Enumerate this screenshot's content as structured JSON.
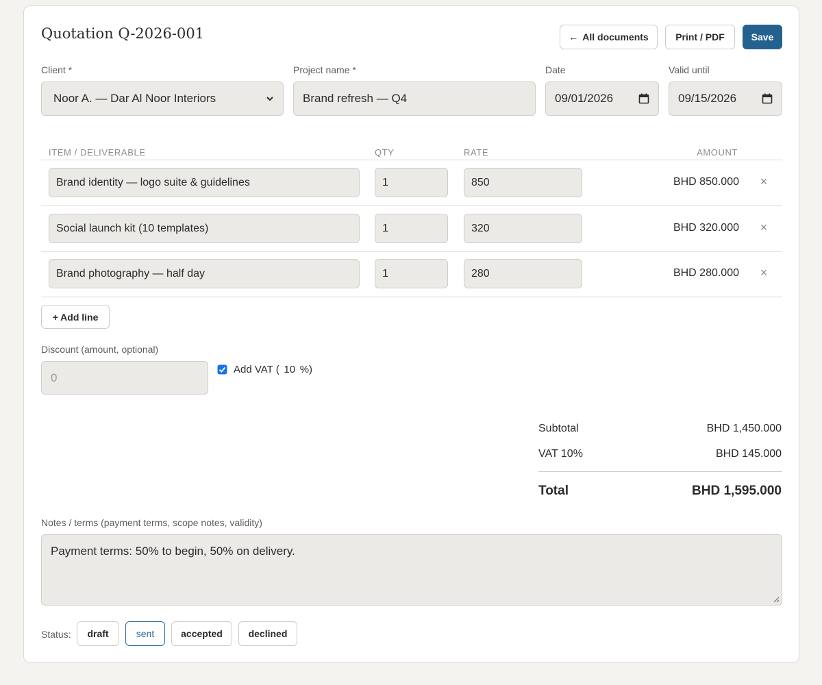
{
  "header": {
    "title": "Quotation Q-2026-001",
    "all_documents_label": "All documents",
    "print_label": "Print / PDF",
    "save_label": "Save"
  },
  "form": {
    "client": {
      "label": "Client *",
      "value": "Noor A. — Dar Al Noor Interiors"
    },
    "project": {
      "label": "Project name *",
      "value": "Brand refresh — Q4"
    },
    "date": {
      "label": "Date",
      "value": "09/01/2026"
    },
    "valid_until": {
      "label": "Valid until",
      "value": "09/15/2026"
    }
  },
  "table": {
    "headers": {
      "item": "ITEM / DELIVERABLE",
      "qty": "QTY",
      "rate": "RATE",
      "amount": "AMOUNT"
    },
    "rows": [
      {
        "item": "Brand identity — logo suite & guidelines",
        "qty": "1",
        "rate": "850",
        "amount": "BHD 850.000"
      },
      {
        "item": "Social launch kit (10 templates)",
        "qty": "1",
        "rate": "320",
        "amount": "BHD 320.000"
      },
      {
        "item": "Brand photography — half day",
        "qty": "1",
        "rate": "280",
        "amount": "BHD 280.000"
      }
    ],
    "remove_glyph": "×",
    "add_line_label": "+ Add line"
  },
  "discount": {
    "label": "Discount (amount, optional)",
    "placeholder": "0"
  },
  "vat": {
    "checked": true,
    "prefix": "Add VAT (",
    "rate": "10",
    "suffix": "%)"
  },
  "totals": {
    "subtotal_label": "Subtotal",
    "subtotal_value": "BHD 1,450.000",
    "vat_label": "VAT 10%",
    "vat_value": "BHD 145.000",
    "total_label": "Total",
    "total_value": "BHD 1,595.000"
  },
  "notes": {
    "label": "Notes / terms (payment terms, scope notes, validity)",
    "value": "Payment terms: 50% to begin, 50% on delivery."
  },
  "status": {
    "label": "Status:",
    "options": [
      "draft",
      "sent",
      "accepted",
      "declined"
    ],
    "selected": "sent"
  },
  "colors": {
    "primary": "#25618f",
    "active_chip": "#2f6a96",
    "field_bg": "#ebeae6"
  }
}
